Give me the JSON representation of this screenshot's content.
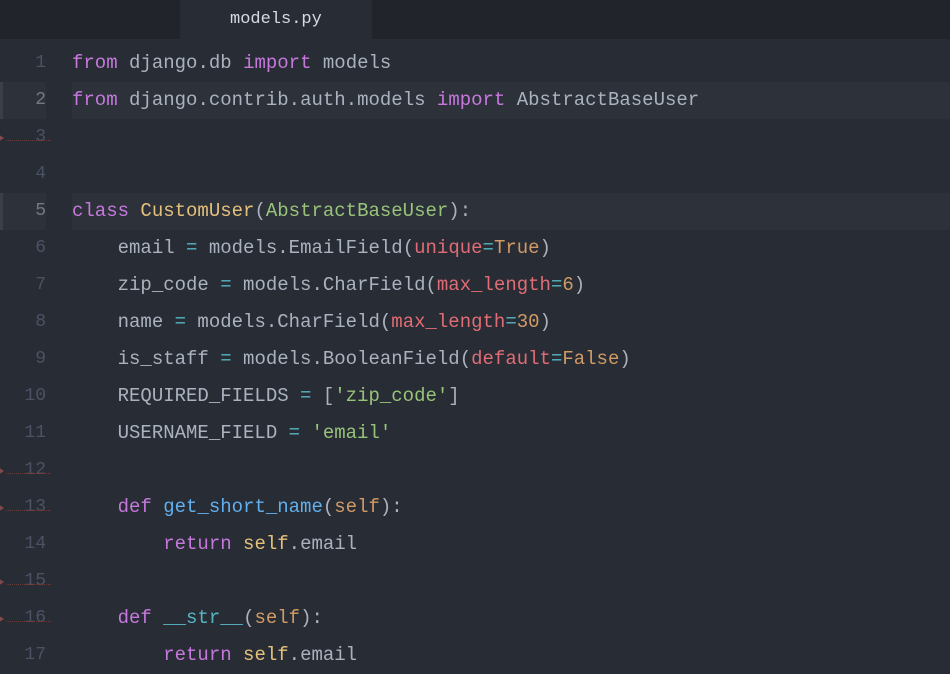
{
  "tab": {
    "filename": "models.py"
  },
  "gutter": {
    "lines": [
      1,
      2,
      3,
      4,
      5,
      6,
      7,
      8,
      9,
      10,
      11,
      12,
      13,
      14,
      15,
      16,
      17
    ],
    "highlighted": [
      2,
      5
    ],
    "fold_markers": [
      3,
      12,
      13,
      15,
      16
    ]
  },
  "code": {
    "lines": [
      {
        "n": 1,
        "tokens": [
          [
            "kw-import",
            "from"
          ],
          [
            "text",
            " django"
          ],
          [
            "punct",
            "."
          ],
          [
            "text",
            "db "
          ],
          [
            "kw-import",
            "import"
          ],
          [
            "text",
            " models"
          ]
        ]
      },
      {
        "n": 2,
        "highlighted": true,
        "tokens": [
          [
            "kw-import",
            "from"
          ],
          [
            "text",
            " django"
          ],
          [
            "punct",
            "."
          ],
          [
            "text",
            "contrib"
          ],
          [
            "punct",
            "."
          ],
          [
            "text",
            "auth"
          ],
          [
            "punct",
            "."
          ],
          [
            "text",
            "models "
          ],
          [
            "kw-import",
            "import"
          ],
          [
            "text",
            " AbstractBaseUser"
          ]
        ]
      },
      {
        "n": 3,
        "tokens": []
      },
      {
        "n": 4,
        "tokens": []
      },
      {
        "n": 5,
        "highlighted": true,
        "tokens": [
          [
            "kw-class",
            "class"
          ],
          [
            "text",
            " "
          ],
          [
            "classname",
            "CustomUser"
          ],
          [
            "punct",
            "("
          ],
          [
            "inherit",
            "AbstractBaseUser"
          ],
          [
            "punct",
            ")"
          ],
          [
            "punct",
            ":"
          ]
        ]
      },
      {
        "n": 6,
        "tokens": [
          [
            "text",
            "    email "
          ],
          [
            "op",
            "="
          ],
          [
            "text",
            " models"
          ],
          [
            "punct",
            "."
          ],
          [
            "text",
            "EmailField"
          ],
          [
            "punct",
            "("
          ],
          [
            "paramname",
            "unique"
          ],
          [
            "op",
            "="
          ],
          [
            "bool",
            "True"
          ],
          [
            "punct",
            ")"
          ]
        ]
      },
      {
        "n": 7,
        "tokens": [
          [
            "text",
            "    zip_code "
          ],
          [
            "op",
            "="
          ],
          [
            "text",
            " models"
          ],
          [
            "punct",
            "."
          ],
          [
            "text",
            "CharField"
          ],
          [
            "punct",
            "("
          ],
          [
            "paramname",
            "max_length"
          ],
          [
            "op",
            "="
          ],
          [
            "num",
            "6"
          ],
          [
            "punct",
            ")"
          ]
        ]
      },
      {
        "n": 8,
        "tokens": [
          [
            "text",
            "    name "
          ],
          [
            "op",
            "="
          ],
          [
            "text",
            " models"
          ],
          [
            "punct",
            "."
          ],
          [
            "text",
            "CharField"
          ],
          [
            "punct",
            "("
          ],
          [
            "paramname",
            "max_length"
          ],
          [
            "op",
            "="
          ],
          [
            "num",
            "30"
          ],
          [
            "punct",
            ")"
          ]
        ]
      },
      {
        "n": 9,
        "tokens": [
          [
            "text",
            "    is_staff "
          ],
          [
            "op",
            "="
          ],
          [
            "text",
            " models"
          ],
          [
            "punct",
            "."
          ],
          [
            "text",
            "BooleanField"
          ],
          [
            "punct",
            "("
          ],
          [
            "paramname",
            "default"
          ],
          [
            "op",
            "="
          ],
          [
            "bool",
            "False"
          ],
          [
            "punct",
            ")"
          ]
        ]
      },
      {
        "n": 10,
        "tokens": [
          [
            "text",
            "    REQUIRED_FIELDS "
          ],
          [
            "op",
            "="
          ],
          [
            "text",
            " "
          ],
          [
            "bracket",
            "["
          ],
          [
            "string",
            "'zip_code'"
          ],
          [
            "bracket",
            "]"
          ]
        ]
      },
      {
        "n": 11,
        "tokens": [
          [
            "text",
            "    USERNAME_FIELD "
          ],
          [
            "op",
            "="
          ],
          [
            "text",
            " "
          ],
          [
            "string",
            "'email'"
          ]
        ]
      },
      {
        "n": 12,
        "tokens": []
      },
      {
        "n": 13,
        "tokens": [
          [
            "text",
            "    "
          ],
          [
            "kw-def",
            "def"
          ],
          [
            "text",
            " "
          ],
          [
            "funcname",
            "get_short_name"
          ],
          [
            "punct",
            "("
          ],
          [
            "param",
            "self"
          ],
          [
            "punct",
            ")"
          ],
          [
            "punct",
            ":"
          ]
        ]
      },
      {
        "n": 14,
        "tokens": [
          [
            "text",
            "        "
          ],
          [
            "kw-return",
            "return"
          ],
          [
            "text",
            " "
          ],
          [
            "self",
            "self"
          ],
          [
            "punct",
            "."
          ],
          [
            "text",
            "email"
          ]
        ]
      },
      {
        "n": 15,
        "tokens": []
      },
      {
        "n": 16,
        "tokens": [
          [
            "text",
            "    "
          ],
          [
            "kw-def",
            "def"
          ],
          [
            "text",
            " "
          ],
          [
            "dunder",
            "__str__"
          ],
          [
            "punct",
            "("
          ],
          [
            "param",
            "self"
          ],
          [
            "punct",
            ")"
          ],
          [
            "punct",
            ":"
          ]
        ]
      },
      {
        "n": 17,
        "tokens": [
          [
            "text",
            "        "
          ],
          [
            "kw-return",
            "return"
          ],
          [
            "text",
            " "
          ],
          [
            "self",
            "self"
          ],
          [
            "punct",
            "."
          ],
          [
            "text",
            "email"
          ]
        ]
      }
    ]
  }
}
